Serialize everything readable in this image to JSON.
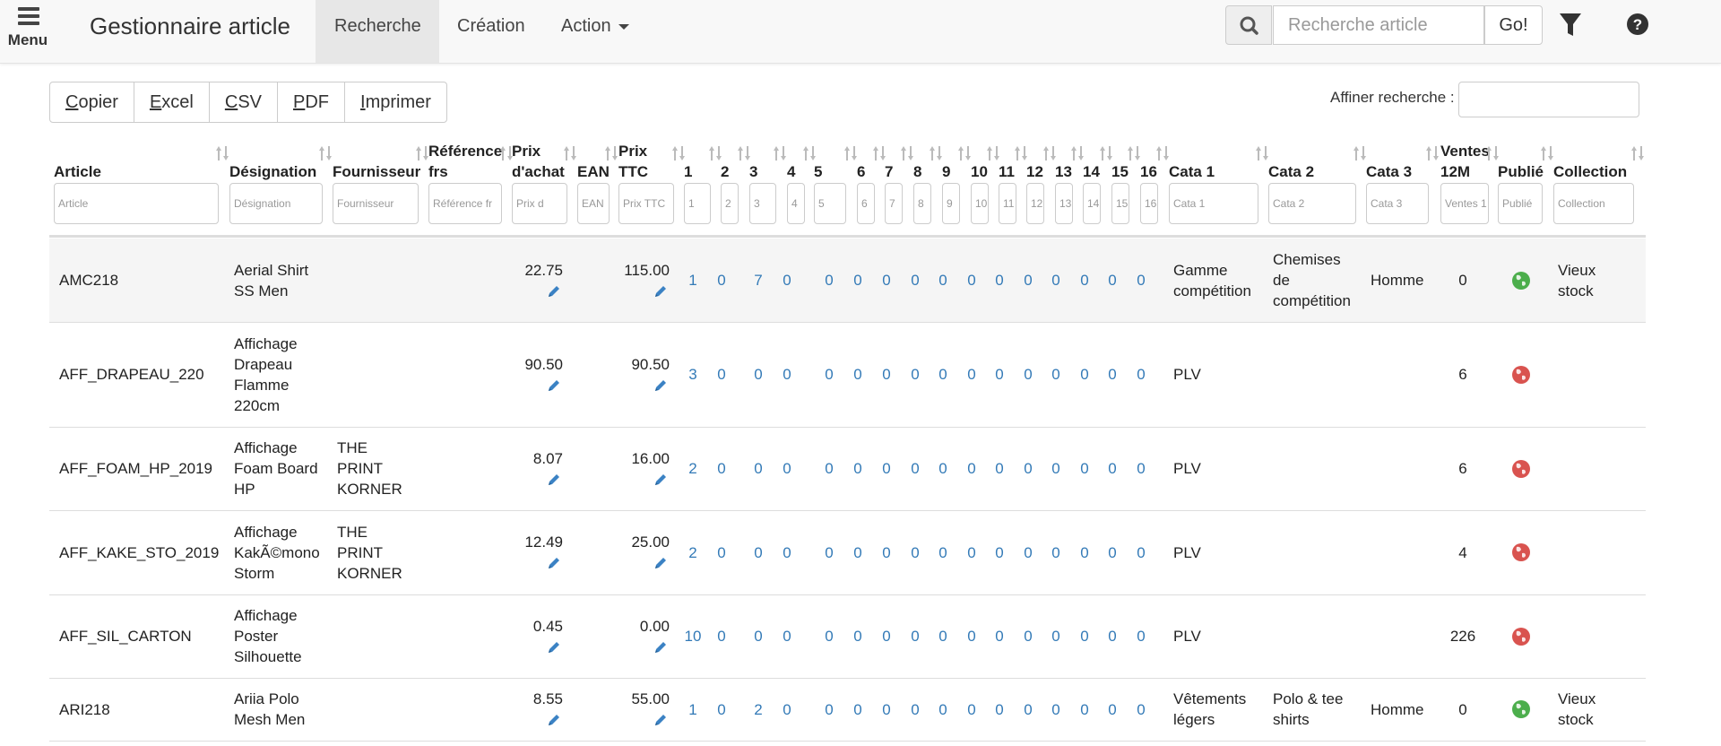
{
  "navbar": {
    "menu_label": "Menu",
    "brand": "Gestionnaire article",
    "nav_recherche": "Recherche",
    "nav_creation": "Création",
    "nav_action": "Action",
    "search_placeholder": "Recherche article",
    "go_label": "Go!"
  },
  "toolbar": {
    "copier_first": "C",
    "copier_rest": "opier",
    "excel_first": "E",
    "excel_rest": "xcel",
    "csv_first": "C",
    "csv_rest": "SV",
    "pdf_first": "P",
    "pdf_rest": "DF",
    "imprimer_first": "I",
    "imprimer_rest": "mprimer",
    "affiner_label": "Affiner recherche :"
  },
  "columns": {
    "article": {
      "label": "Article",
      "filter": "Article"
    },
    "designation": {
      "label": "Désignation",
      "filter": "Désignation"
    },
    "fournisseur": {
      "label": "Fournisseur",
      "filter": "Fournisseur"
    },
    "reference": {
      "label1": "Référence",
      "label2": "frs",
      "filter": "Référence fr"
    },
    "prix_achat": {
      "label1": "Prix",
      "label2": "d'achat",
      "filter": "Prix d"
    },
    "ean": {
      "label": "EAN",
      "filter": "EAN"
    },
    "prix_ttc": {
      "label1": "Prix",
      "label2": "TTC",
      "filter": "Prix TTC"
    },
    "c1": {
      "label": "1",
      "filter": "1"
    },
    "c2": {
      "label": "2",
      "filter": "2"
    },
    "c3": {
      "label": "3",
      "filter": "3"
    },
    "c4": {
      "label": "4",
      "filter": "4"
    },
    "c5": {
      "label": "5",
      "filter": "5"
    },
    "c6": {
      "label": "6",
      "filter": "6"
    },
    "c7": {
      "label": "7",
      "filter": "7"
    },
    "c8": {
      "label": "8",
      "filter": "8"
    },
    "c9": {
      "label": "9",
      "filter": "9"
    },
    "c10": {
      "label": "10",
      "filter": "10"
    },
    "c11": {
      "label": "11",
      "filter": "11"
    },
    "c12": {
      "label": "12",
      "filter": "12"
    },
    "c13": {
      "label": "13",
      "filter": "13"
    },
    "c14": {
      "label": "14",
      "filter": "14"
    },
    "c15": {
      "label": "15",
      "filter": "15"
    },
    "c16": {
      "label": "16",
      "filter": "16"
    },
    "cata1": {
      "label": "Cata 1",
      "filter": "Cata 1"
    },
    "cata2": {
      "label": "Cata 2",
      "filter": "Cata 2"
    },
    "cata3": {
      "label": "Cata 3",
      "filter": "Cata 3"
    },
    "ventes": {
      "label1": "Ventes",
      "label2": "12M",
      "filter": "Ventes 1"
    },
    "publie": {
      "label": "Publié",
      "filter": "Publié"
    },
    "collection": {
      "label": "Collection",
      "filter": "Collection"
    }
  },
  "rows": [
    {
      "article": "AMC218",
      "designation": [
        "Aerial Shirt",
        "SS Men"
      ],
      "fournisseur": [],
      "prix_achat": "22.75",
      "prix_ttc": "115.00",
      "sizes": [
        "1",
        "0",
        "7",
        "0",
        "0",
        "0",
        "0",
        "0",
        "0",
        "0",
        "0",
        "0",
        "0",
        "0",
        "0",
        "0"
      ],
      "cata1": [
        "Gamme",
        "compétition"
      ],
      "cata2": [
        "Chemises",
        "de",
        "compétition"
      ],
      "cata3": "Homme",
      "ventes": "0",
      "publie": "green",
      "collection": [
        "Vieux",
        "stock"
      ]
    },
    {
      "article": "AFF_DRAPEAU_220",
      "designation": [
        "Affichage",
        "Drapeau",
        "Flamme",
        "220cm"
      ],
      "fournisseur": [],
      "prix_achat": "90.50",
      "prix_ttc": "90.50",
      "sizes": [
        "3",
        "0",
        "0",
        "0",
        "0",
        "0",
        "0",
        "0",
        "0",
        "0",
        "0",
        "0",
        "0",
        "0",
        "0",
        "0"
      ],
      "cata1": [
        "PLV"
      ],
      "cata2": [],
      "cata3": "",
      "ventes": "6",
      "publie": "red",
      "collection": []
    },
    {
      "article": "AFF_FOAM_HP_2019",
      "designation": [
        "Affichage",
        "Foam Board",
        "HP"
      ],
      "fournisseur": [
        "THE",
        "PRINT",
        "KORNER"
      ],
      "prix_achat": "8.07",
      "prix_ttc": "16.00",
      "sizes": [
        "2",
        "0",
        "0",
        "0",
        "0",
        "0",
        "0",
        "0",
        "0",
        "0",
        "0",
        "0",
        "0",
        "0",
        "0",
        "0"
      ],
      "cata1": [
        "PLV"
      ],
      "cata2": [],
      "cata3": "",
      "ventes": "6",
      "publie": "red",
      "collection": []
    },
    {
      "article": "AFF_KAKE_STO_2019",
      "designation": [
        "Affichage",
        "KakÃ©mono",
        "Storm"
      ],
      "fournisseur": [
        "THE",
        "PRINT",
        "KORNER"
      ],
      "prix_achat": "12.49",
      "prix_ttc": "25.00",
      "sizes": [
        "2",
        "0",
        "0",
        "0",
        "0",
        "0",
        "0",
        "0",
        "0",
        "0",
        "0",
        "0",
        "0",
        "0",
        "0",
        "0"
      ],
      "cata1": [
        "PLV"
      ],
      "cata2": [],
      "cata3": "",
      "ventes": "4",
      "publie": "red",
      "collection": []
    },
    {
      "article": "AFF_SIL_CARTON",
      "designation": [
        "Affichage",
        "Poster",
        "Silhouette"
      ],
      "fournisseur": [],
      "prix_achat": "0.45",
      "prix_ttc": "0.00",
      "sizes": [
        "10",
        "0",
        "0",
        "0",
        "0",
        "0",
        "0",
        "0",
        "0",
        "0",
        "0",
        "0",
        "0",
        "0",
        "0",
        "0"
      ],
      "cata1": [
        "PLV"
      ],
      "cata2": [],
      "cata3": "",
      "ventes": "226",
      "publie": "red",
      "collection": []
    },
    {
      "article": "ARI218",
      "designation": [
        "Ariia Polo",
        "Mesh Men"
      ],
      "fournisseur": [],
      "prix_achat": "8.55",
      "prix_ttc": "55.00",
      "sizes": [
        "1",
        "0",
        "2",
        "0",
        "0",
        "0",
        "0",
        "0",
        "0",
        "0",
        "0",
        "0",
        "0",
        "0",
        "0",
        "0"
      ],
      "cata1": [
        "Vêtements",
        "légers"
      ],
      "cata2": [
        "Polo & tee",
        "shirts"
      ],
      "cata3": "Homme",
      "ventes": "0",
      "publie": "green",
      "collection": [
        "Vieux",
        "stock"
      ]
    }
  ],
  "colors": {
    "link": "#337ab7",
    "green": "#4cae4c",
    "red": "#d9534f"
  }
}
